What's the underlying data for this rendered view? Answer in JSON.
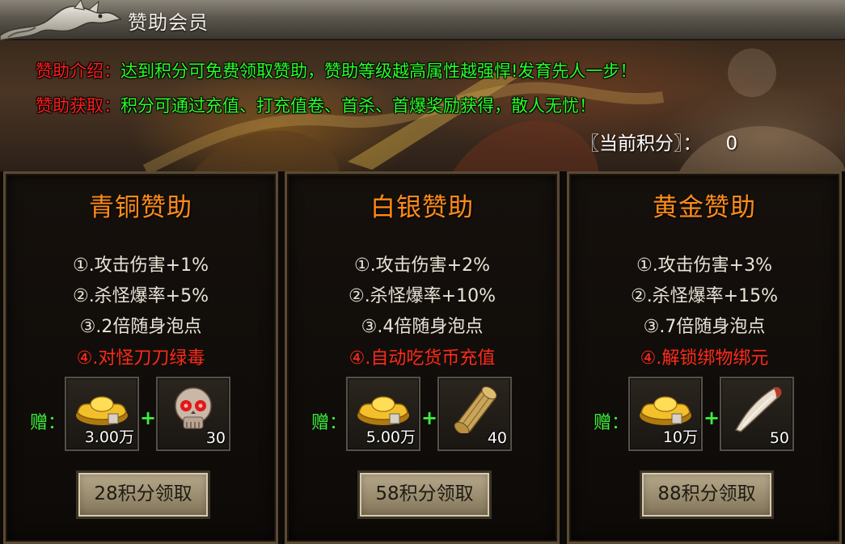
{
  "window": {
    "title": "赞助会员"
  },
  "intro": [
    {
      "label": "赞助介绍：",
      "text": "达到积分可免费领取赞助，赞助等级越高属性越强悍!发育先人一步！"
    },
    {
      "label": "赞助获取：",
      "text": "积分可通过充值、打充值卷、首杀、首爆奖励获得，散人无忧！"
    }
  ],
  "score": {
    "label": "〖当前积分〗：",
    "value": "0"
  },
  "gift_label": "赠：",
  "plus_sign": "+",
  "tiers": [
    {
      "title": "青铜赞助",
      "perks": [
        "①.攻击伤害+1%",
        "②.杀怪爆率+5%",
        "③.2倍随身泡点",
        "④.对怪刀刀绿毒"
      ],
      "rewards": [
        {
          "icon": "gold-ingot-icon",
          "count": "3.00万"
        },
        {
          "icon": "red-eyed-skull-icon",
          "count": "30"
        }
      ],
      "button": "28积分领取"
    },
    {
      "title": "白银赞助",
      "perks": [
        "①.攻击伤害+2%",
        "②.杀怪爆率+10%",
        "③.4倍随身泡点",
        "④.自动吃货币充值"
      ],
      "rewards": [
        {
          "icon": "gold-ingot-icon",
          "count": "5.00万"
        },
        {
          "icon": "scroll-icon",
          "count": "40"
        }
      ],
      "button": "58积分领取"
    },
    {
      "title": "黄金赞助",
      "perks": [
        "①.攻击伤害+3%",
        "②.杀怪爆率+15%",
        "③.7倍随身泡点",
        "④.解锁绑物绑元"
      ],
      "rewards": [
        {
          "icon": "gold-ingot-icon",
          "count": "10万"
        },
        {
          "icon": "beast-fang-icon",
          "count": "50"
        }
      ],
      "button": "88积分领取"
    }
  ],
  "colors": {
    "intro_label": "#ff1e1e",
    "intro_text": "#29ff29",
    "tier_title": "#ff8c1a",
    "special_perk": "#ff2a1a",
    "gift_label": "#3cf03c"
  }
}
